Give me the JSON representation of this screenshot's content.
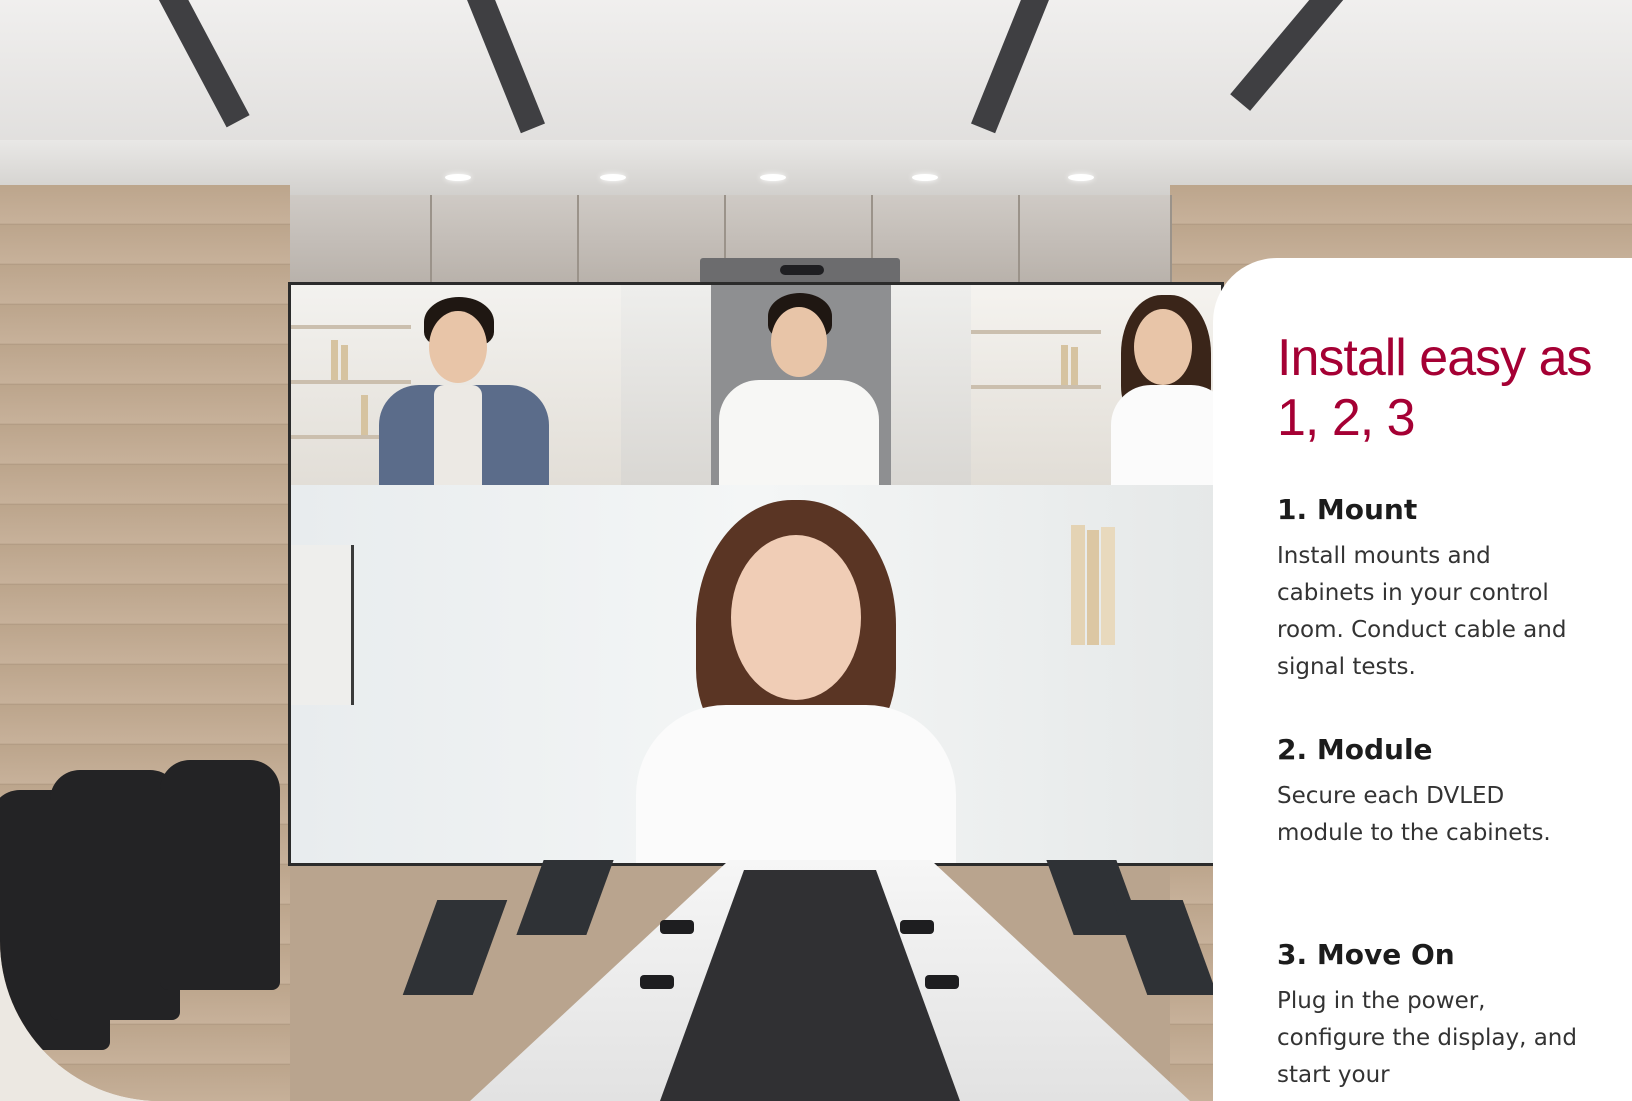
{
  "card": {
    "heading": "Install easy as 1, 2, 3",
    "steps": [
      {
        "title": "1. Mount",
        "description": "Install mounts and cabinets in your control room. Conduct cable and signal tests."
      },
      {
        "title": "2. Module",
        "description": "Secure each DVLED module to the cabinets."
      },
      {
        "title": "3. Move On",
        "description": "Plug in the power, configure the display, and start your"
      }
    ]
  },
  "colors": {
    "accent": "#a50034",
    "card_background": "#ffffff",
    "page_background": "#ece8e2"
  },
  "scene": {
    "subject": "conference room with DVLED video wall showing video call participants"
  }
}
